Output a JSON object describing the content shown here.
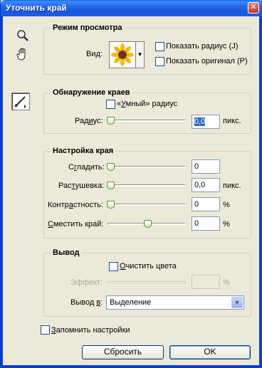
{
  "window": {
    "title": "Уточнить край",
    "close_glyph": "✕"
  },
  "tools": [
    {
      "name": "zoom-tool",
      "icon": "magnifier-icon"
    },
    {
      "name": "hand-tool",
      "icon": "hand-icon"
    },
    {
      "name": "refine-radius-tool",
      "icon": "brush-icon"
    }
  ],
  "view_mode": {
    "legend": "Режим просмотра",
    "view_label": "Вид:",
    "view_value_icon": "sunflower-thumbnail",
    "show_radius": {
      "label": "Показать радиус (J)",
      "checked": false
    },
    "show_original": {
      "label": "Показать оригинал (P)",
      "checked": false
    }
  },
  "edge_detection": {
    "legend": "Обнаружение краев",
    "smart_radius": {
      "label": "«Умный» радиус",
      "checked": false
    },
    "radius": {
      "label": "Радиус:",
      "value": "0,0",
      "unit": "пикс.",
      "slider_fraction": 0.0
    }
  },
  "adjust_edge": {
    "legend": "Настройка края",
    "smooth": {
      "label": "Сгладить:",
      "value": "0",
      "unit": "",
      "slider_fraction": 0.0
    },
    "feather": {
      "label": "Растушевка:",
      "value": "0,0",
      "unit": "пикс.",
      "slider_fraction": 0.0
    },
    "contrast": {
      "label": "Контрастность:",
      "value": "0",
      "unit": "%",
      "slider_fraction": 0.0
    },
    "shift_edge": {
      "label": "Сместить край:",
      "value": "0",
      "unit": "%",
      "slider_fraction": 0.5
    }
  },
  "output": {
    "legend": "Вывод",
    "decontaminate": {
      "label": "Очистить цвета",
      "checked": false
    },
    "amount": {
      "label": "Эффект:",
      "value": "",
      "unit": "%"
    },
    "output_to": {
      "label": "Вывод в:",
      "value": "Выделение"
    }
  },
  "remember": {
    "label": "Запомнить настройки",
    "checked": false
  },
  "buttons": {
    "reset": "Сбросить",
    "ok": "OK"
  },
  "colors": {
    "titlebar": "#2468e8",
    "dialog_bg": "#ece9d8",
    "accent": "#316ac5"
  }
}
